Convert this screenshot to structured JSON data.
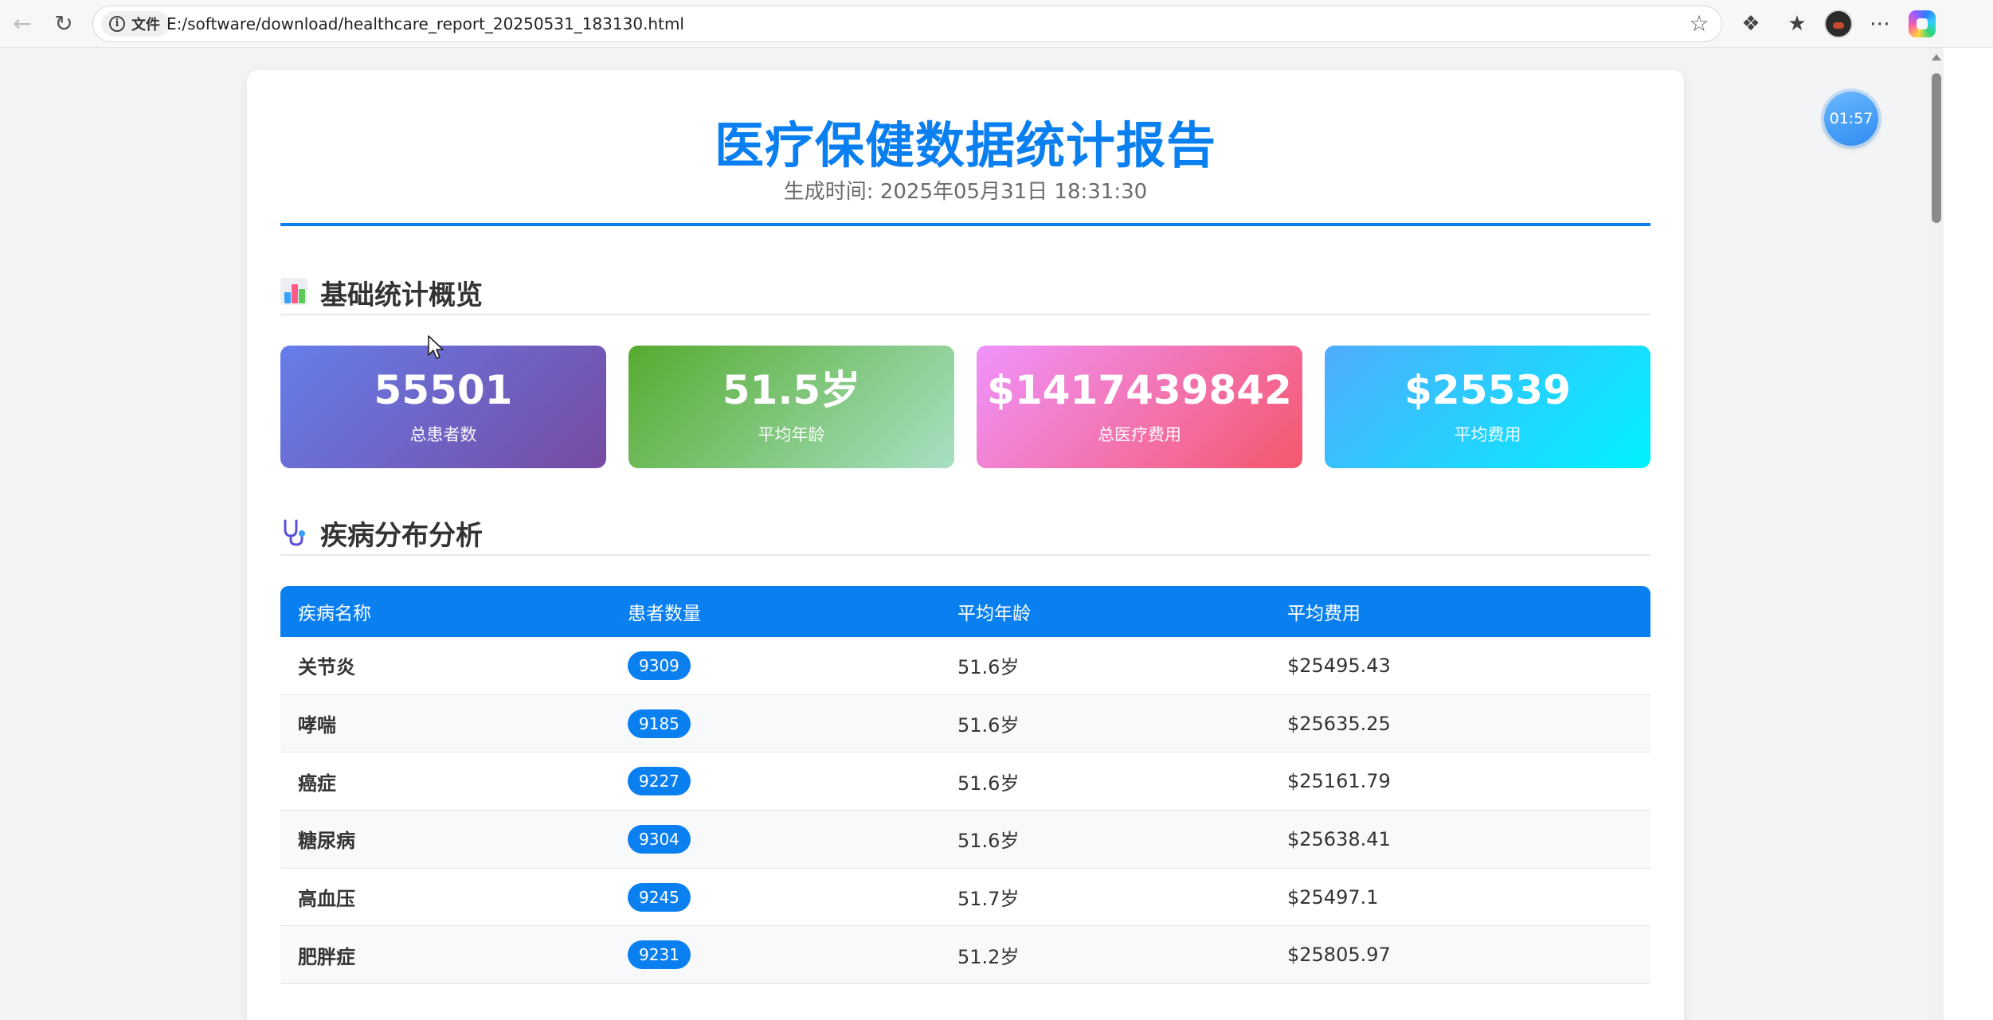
{
  "browser": {
    "site_label": "文件",
    "url": "E:/software/download/healthcare_report_20250531_183130.html"
  },
  "timer": "01:57",
  "report": {
    "title": "医疗保健数据统计报告",
    "generated": "生成时间: 2025年05月31日 18:31:30"
  },
  "overview": {
    "title": "基础统计概览",
    "icon": "bar-chart-icon",
    "cards": [
      {
        "value": "55501",
        "label": "总患者数",
        "gradient": [
          "#667eea",
          "#764ba2"
        ]
      },
      {
        "value": "51.5岁",
        "label": "平均年龄",
        "gradient": [
          "#56ab2f",
          "#a8e0c4"
        ]
      },
      {
        "value": "$1417439842",
        "label": "总医疗费用",
        "gradient": [
          "#f093fb",
          "#f5576c"
        ]
      },
      {
        "value": "$25539",
        "label": "平均费用",
        "gradient": [
          "#4facfe",
          "#00f2fe"
        ]
      }
    ]
  },
  "disease": {
    "title": "疾病分布分析",
    "icon": "stethoscope-icon",
    "headers": [
      "疾病名称",
      "患者数量",
      "平均年龄",
      "平均费用"
    ],
    "rows": [
      {
        "name": "关节炎",
        "count": "9309",
        "age": "51.6岁",
        "cost": "$25495.43"
      },
      {
        "name": "哮喘",
        "count": "9185",
        "age": "51.6岁",
        "cost": "$25635.25"
      },
      {
        "name": "癌症",
        "count": "9227",
        "age": "51.6岁",
        "cost": "$25161.79"
      },
      {
        "name": "糖尿病",
        "count": "9304",
        "age": "51.6岁",
        "cost": "$25638.41"
      },
      {
        "name": "高血压",
        "count": "9245",
        "age": "51.7岁",
        "cost": "$25497.1"
      },
      {
        "name": "肥胖症",
        "count": "9231",
        "age": "51.2岁",
        "cost": "$25805.97"
      }
    ]
  },
  "colors": {
    "accent": "#0a7ff0",
    "page_bg": "#f3f4f6"
  }
}
